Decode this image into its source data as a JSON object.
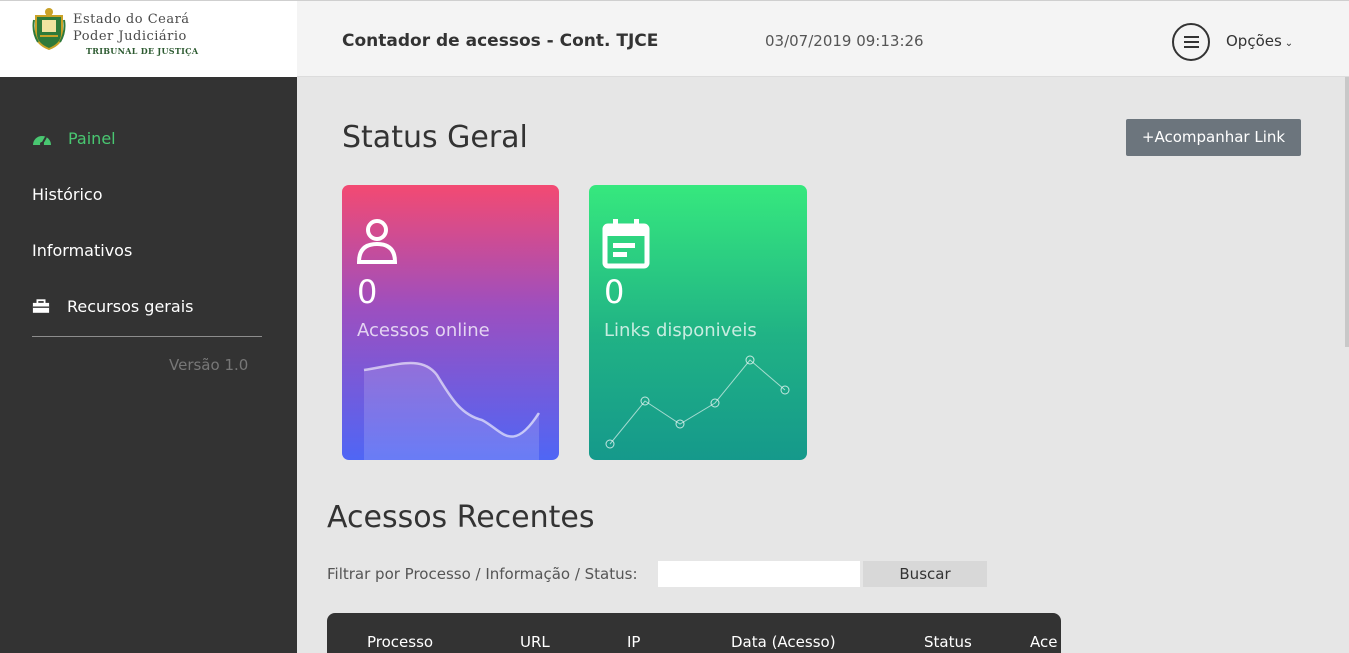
{
  "logo": {
    "line1": "Estado do Ceará",
    "line2": "Poder Judiciário",
    "line3": "TRIBUNAL DE JUSTIÇA"
  },
  "header": {
    "title": "Contador de acessos - Cont. TJCE",
    "datetime": "03/07/2019 09:13:26",
    "options_label": "Opções"
  },
  "sidebar": {
    "items": [
      {
        "label": "Painel",
        "icon": "dashboard-icon",
        "active": true
      },
      {
        "label": "Histórico"
      },
      {
        "label": "Informativos"
      },
      {
        "label": "Recursos gerais",
        "icon": "briefcase-icon"
      }
    ],
    "version": "Versão 1.0"
  },
  "main": {
    "status_title": "Status Geral",
    "follow_button": "+Acompanhar Link",
    "cards": [
      {
        "value": "0",
        "label": "Acessos online",
        "icon": "user-icon"
      },
      {
        "value": "0",
        "label": "Links disponiveis",
        "icon": "calendar-icon"
      }
    ],
    "recent_title": "Acessos Recentes",
    "filter_label": "Filtrar por Processo / Informação / Status:",
    "filter_value": "",
    "search_button": "Buscar",
    "table_headers": [
      "Processo",
      "URL",
      "IP",
      "Data (Acesso)",
      "Status",
      "Ace"
    ]
  },
  "colors": {
    "active_nav": "#49c771",
    "sidebar_bg": "#333333",
    "card1_top": "#f34a72",
    "card1_bottom": "#4f66f5",
    "card2_top": "#36e87e",
    "card2_bottom": "#15998b"
  }
}
